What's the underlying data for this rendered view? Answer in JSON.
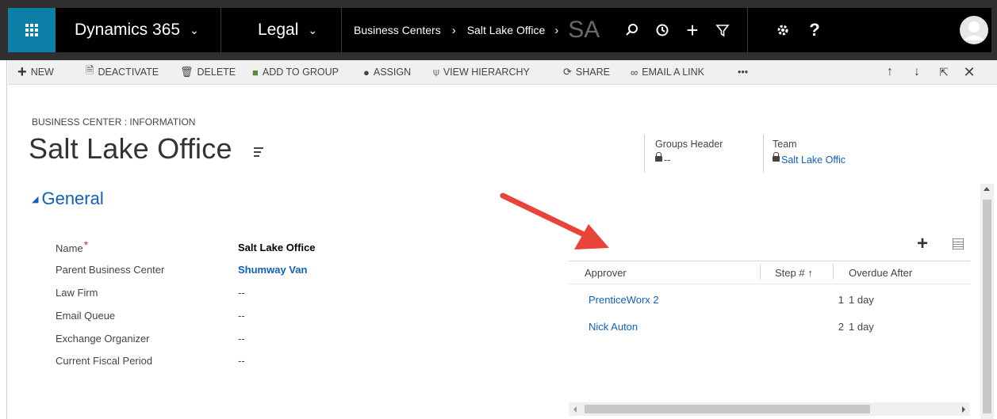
{
  "nav": {
    "app_name": "Dynamics 365",
    "area": "Legal",
    "breadcrumb_parent": "Business Centers",
    "breadcrumb_current": "Salt Lake Office",
    "breadcrumb_ghost": "SA",
    "help": "?",
    "icons": [
      "waffle-icon",
      "search-icon",
      "history-icon",
      "plus-icon",
      "filter-icon",
      "settings-icon",
      "help-icon",
      "avatar"
    ]
  },
  "commands": {
    "new": "NEW",
    "deactivate": "DEACTIVATE",
    "delete": "DELETE",
    "add_to_group": "ADD TO GROUP",
    "assign": "ASSIGN",
    "view_hierarchy": "VIEW HIERARCHY",
    "share": "SHARE",
    "email_link": "EMAIL A LINK",
    "more": "•••"
  },
  "header": {
    "entity_label": "BUSINESS CENTER : INFORMATION",
    "title": "Salt Lake Office",
    "groups_header_label": "Groups Header",
    "groups_header_value": "--",
    "team_label": "Team",
    "team_value": "Salt Lake Offic"
  },
  "section": {
    "title": "General"
  },
  "fields": [
    {
      "label": "Name",
      "value": "Salt Lake Office"
    },
    {
      "label": "Parent Business Center",
      "value": "Shumway Van"
    },
    {
      "label": "Law Firm",
      "value": "--"
    },
    {
      "label": "Email Queue",
      "value": "--"
    },
    {
      "label": "Exchange Organizer",
      "value": "--"
    },
    {
      "label": "Current Fiscal Period",
      "value": "--"
    }
  ],
  "required_marker": "*",
  "subgrid": {
    "columns": [
      "Approver",
      "Step #",
      "Overdue After"
    ],
    "sort_indicator": "↑",
    "rows": [
      {
        "approver": "PrenticeWorx 2",
        "step": "1",
        "overdue": "1 day"
      },
      {
        "approver": "Nick Auton",
        "step": "2",
        "overdue": "1 day"
      }
    ]
  },
  "colors": {
    "nav_bg": "#000000",
    "waffle_bg": "#0b7fa6",
    "link": "#1160b7",
    "required": "#d52b1e",
    "annotation_arrow": "#e8443a"
  }
}
